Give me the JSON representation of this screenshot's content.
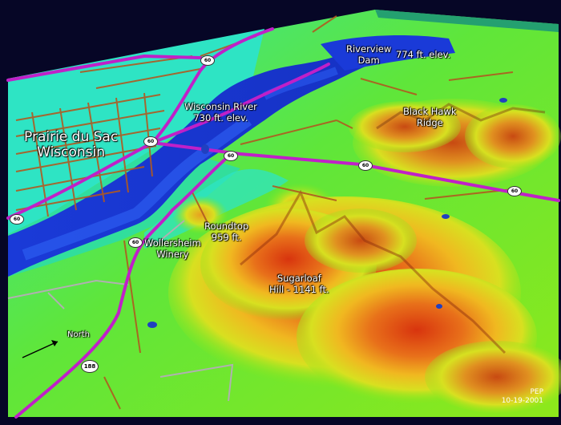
{
  "places": {
    "town": [
      "Prairie du Sac",
      "Wisconsin"
    ],
    "river": [
      "Wisconsin River",
      "730 ft. elev."
    ],
    "dam": [
      "Riverview",
      "Dam"
    ],
    "dam_elev": "774 ft. elev.",
    "ridge": [
      "Black Hawk",
      "Ridge"
    ],
    "roundtop": [
      "Roundtop",
      "959 ft."
    ],
    "winery": [
      "Wollersheim",
      "Winery"
    ],
    "sugarloaf": [
      "Sugarloaf",
      "Hill - 1141 ft."
    ]
  },
  "compass": {
    "label": "North"
  },
  "credit": {
    "initials": "PEP",
    "date": "10-19-2001"
  },
  "highway_shields": {
    "main": "188",
    "route": "60"
  },
  "colors": {
    "water": "#1a3ad8",
    "lowland": "#27e3b0",
    "midland": "#7ee81c",
    "highland": "#d13a10",
    "highway": "#c020c8",
    "roads": "#b05a20",
    "background": "#060626"
  }
}
